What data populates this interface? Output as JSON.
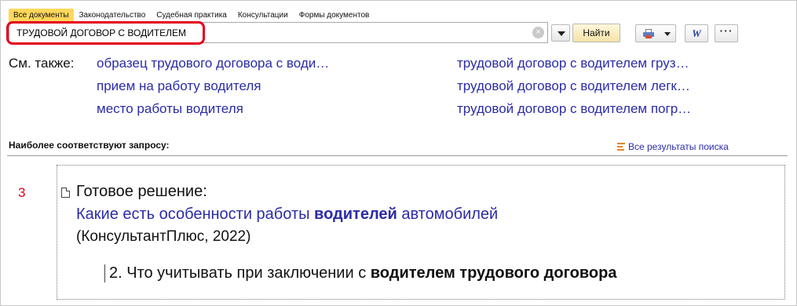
{
  "tabs": [
    {
      "label": "Все документы",
      "active": true
    },
    {
      "label": "Законодательство",
      "active": false
    },
    {
      "label": "Судебная практика",
      "active": false
    },
    {
      "label": "Консультации",
      "active": false
    },
    {
      "label": "Формы документов",
      "active": false
    }
  ],
  "search": {
    "value": "ТРУДОВОЙ ДОГОВОР С ВОДИТЕЛЕМ",
    "clear_symbol": "×",
    "find_label": "Найти"
  },
  "toolbar": {
    "print_icon": "printer-icon",
    "word_label": "W",
    "more_label": "···"
  },
  "see_also": {
    "label": "См. также:",
    "left": [
      "образец трудового договора с води…",
      "прием на работу водителя",
      "место работы водителя"
    ],
    "right": [
      "трудовой договор с водителем груз…",
      "трудовой договор с водителем легк…",
      "трудовой договор с водителем погр…"
    ]
  },
  "results": {
    "heading": "Наиболее соответствуют запросу:",
    "all_results_label": "Все результаты поиска",
    "item": {
      "number": "3",
      "type": "Готовое решение:",
      "title_pre": "Какие есть особенности работы ",
      "title_bold": "водителей",
      "title_post": " автомобилей",
      "source": "(КонсультантПлюс, 2022)",
      "snippet_pre": "2. Что учитывать при заключении с ",
      "snippet_bold": "водителем трудового договора"
    }
  },
  "colors": {
    "accent_tab": "#ffd75a",
    "link": "#2b2ba8",
    "highlight": "#e3001b"
  }
}
